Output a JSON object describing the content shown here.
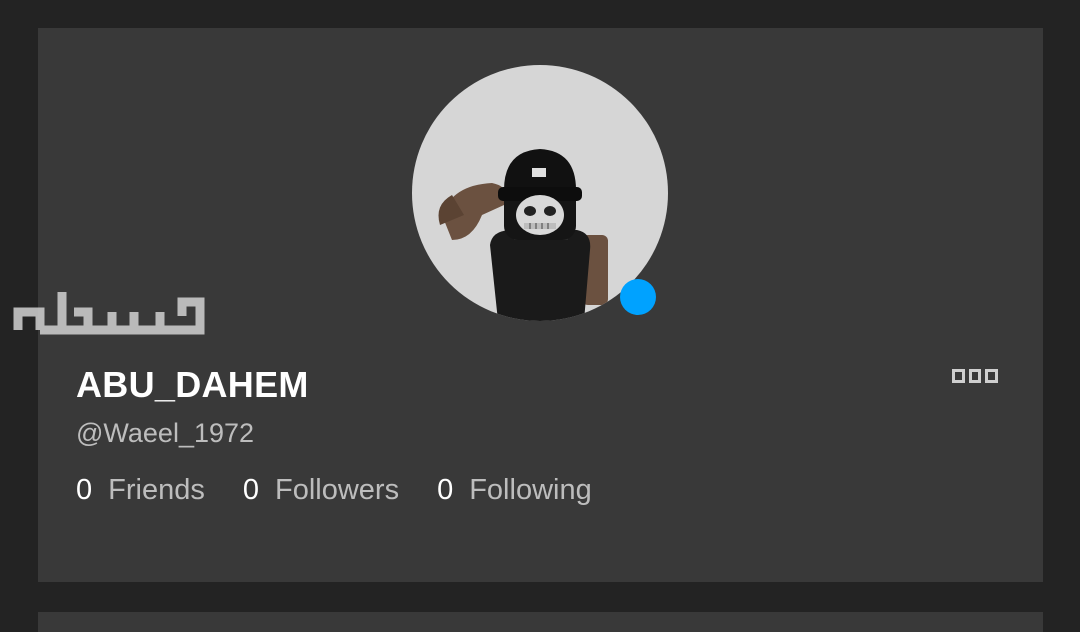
{
  "profile": {
    "display_name": "ABU_DAHEM",
    "username": "@Waeel_1972",
    "avatar_icon": "avatar-image",
    "presence_color": "#00a2ff",
    "online": true
  },
  "stats": [
    {
      "count": "0",
      "label": "Friends"
    },
    {
      "count": "0",
      "label": "Followers"
    },
    {
      "count": "0",
      "label": "Following"
    }
  ],
  "menu": {
    "icon": "more-options-icon"
  },
  "watermark": {
    "text": "مستعمل"
  },
  "colors": {
    "page_bg": "#232323",
    "card_bg": "#393939",
    "text_primary": "#ffffff",
    "text_secondary": "#bdbdbd",
    "presence": "#00a2ff"
  }
}
